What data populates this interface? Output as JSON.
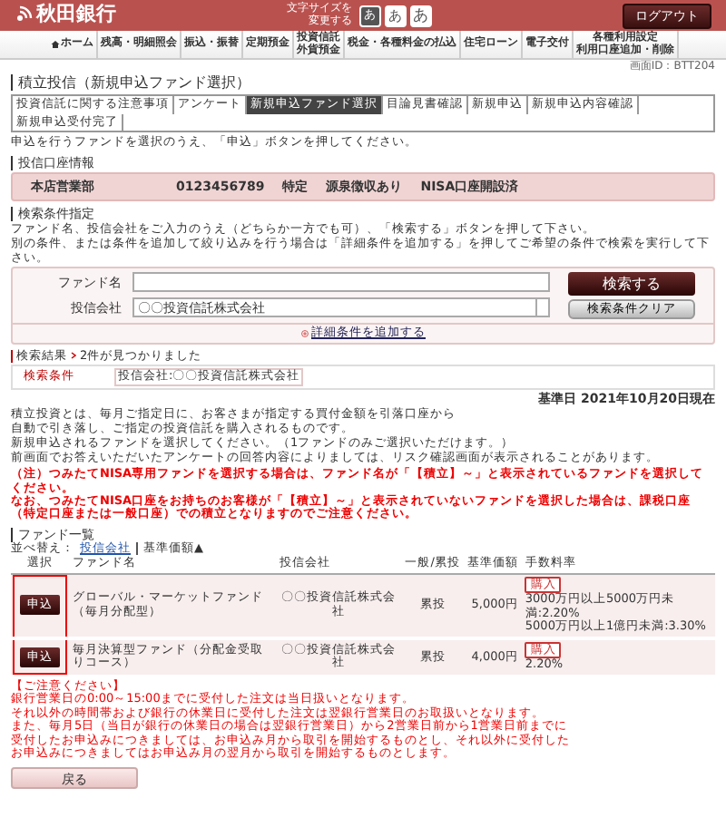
{
  "header": {
    "logo": "秋田銀行",
    "font_size_label": [
      "文字サイズを",
      "変更する"
    ],
    "font_sizes": [
      {
        "label": "あ",
        "selected": true
      },
      {
        "label": "あ",
        "selected": false
      },
      {
        "label": "あ",
        "selected": false
      }
    ],
    "logout": "ログアウト"
  },
  "nav": [
    {
      "lines": [
        "ホーム"
      ],
      "kind": "home"
    },
    {
      "lines": [
        "残高・明細照会"
      ],
      "kind": "text"
    },
    {
      "lines": [
        "振込・振替"
      ],
      "kind": "text"
    },
    {
      "lines": [
        "定期預金"
      ],
      "kind": "text"
    },
    {
      "lines": [
        "投資信託",
        "外貨預金"
      ],
      "kind": "text"
    },
    {
      "lines": [
        "税金・各種料金の払込"
      ],
      "kind": "text"
    },
    {
      "lines": [
        "住宅ローン"
      ],
      "kind": "text"
    },
    {
      "lines": [
        "電子交付"
      ],
      "kind": "text"
    },
    {
      "lines": [
        "各種利用設定",
        "利用口座追加・削除"
      ],
      "kind": "text"
    }
  ],
  "screen_id": "画面ID：BTT204",
  "title": "積立投信（新規申込ファンド選択）",
  "steps": [
    {
      "label": "投資信託に関する注意事項",
      "selected": false
    },
    {
      "label": "アンケート",
      "selected": false
    },
    {
      "label": "新規申込ファンド選択",
      "selected": true
    },
    {
      "label": "目論見書確認",
      "selected": false
    },
    {
      "label": "新規申込",
      "selected": false
    },
    {
      "label": "新規申込内容確認",
      "selected": false
    },
    {
      "label": "新規申込受付完了",
      "selected": false
    }
  ],
  "instruction": "申込を行うファンドを選択のうえ、「申込」ボタンを押してください。",
  "account": {
    "heading": "投信口座情報",
    "fields": [
      "本店営業部",
      "0123456789",
      "特定",
      "源泉徴収あり",
      "NISA口座開設済"
    ]
  },
  "search": {
    "heading": "検索条件指定",
    "help": [
      "ファンド名、投信会社をご入力のうえ（どちらか一方でも可）、「検索する」ボタンを押して下さい。",
      "別の条件、または条件を追加して絞り込みを行う場合は「詳細条件を追加する」を押してご希望の条件で検索を実行して下さい。"
    ],
    "fund_name_label": "ファンド名",
    "company_label": "投信会社",
    "company_value": "〇〇投資信託株式会社",
    "search_button": "検索する",
    "clear_button": "検索条件クリア",
    "add_condition_link": "詳細条件を追加する"
  },
  "result": {
    "label": "検索結果",
    "count_text": "2件が見つかりました",
    "condition_label": "検索条件",
    "condition_value": "投信会社:〇〇投資信託株式会社"
  },
  "base_date": "基準日 2021年10月20日現在",
  "notes": [
    [
      "積立投資とは、毎月ご指定日に、お客さまが指定する買付金額を引落口座から",
      "自動で引き落し、ご指定の投資信託を購入されるものです。"
    ],
    [
      "新規申込されるファンドを選択してください。（1ファンドのみご選択いただけます。）",
      "前画面でお答えいただいたアンケートの回答内容によりましては、リスク確認画面が表示されることがあります。"
    ]
  ],
  "red_notes": [
    "（注）つみたてNISA専用ファンドを選択する場合は、ファンド名が「【積立】～」と表示されているファンドを選択してください。",
    "なお、つみたてNISA口座をお持ちのお客様が「【積立】～」と表示されていないファンドを選択した場合は、課税口座（特定口座または一般口座）での積立となりますのでご注意ください。"
  ],
  "fund_list": {
    "heading": "ファンド一覧",
    "sort_label": "並べ替え：",
    "sort_options": [
      {
        "label": "投信会社",
        "selected": false
      },
      {
        "label": "基準価額▲",
        "selected": true
      }
    ],
    "columns": [
      "選択",
      "ファンド名",
      "投信会社",
      "一般/累投",
      "基準価額",
      "手数料率"
    ],
    "select_highlighted": true,
    "rows": [
      {
        "button": "申込",
        "name": "グローバル・マーケットファンド（毎月分配型）",
        "company": "〇〇投資信託株式会社",
        "type": "累投",
        "price": "5,000円",
        "fee_tag": "購入",
        "fees": [
          "3000万円以上5000万円未満:2.20%",
          "5000万円以上1億円未満:3.30%"
        ]
      },
      {
        "button": "申込",
        "name": "毎月決算型ファンド（分配金受取りコース）",
        "company": "〇〇投資信託株式会社",
        "type": "累投",
        "price": "4,000円",
        "fee_tag": "購入",
        "fees": [
          "2.20%"
        ]
      }
    ]
  },
  "caution": {
    "title": "【ご注意ください】",
    "lines": [
      "銀行営業日の0:00～15:00までに受付した注文は当日扱いとなります。",
      "それ以外の時間帯および銀行の休業日に受付した注文は翌銀行営業日のお取扱いとなります。",
      "また、毎月5日（当日が銀行の休業日の場合は翌銀行営業日）から2営業日前から1営業日前までに",
      "受付したお申込みにつきましては、お申込み月から取引を開始するものとし、それ以外に受付した",
      "お申込みにつきましてはお申込み月の翌月から取引を開始するものとします。"
    ]
  },
  "back_button": "戻る"
}
